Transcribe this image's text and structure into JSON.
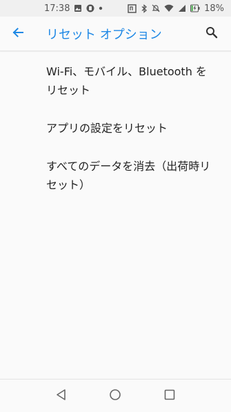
{
  "status_bar": {
    "time": "17:38",
    "battery_percent": "18%"
  },
  "app_bar": {
    "title": "リセット オプション"
  },
  "items": [
    {
      "label": "Wi-Fi、モバイル、Bluetooth をリセット"
    },
    {
      "label": "アプリの設定をリセット"
    },
    {
      "label": "すべてのデータを消去（出荷時リセット）"
    }
  ],
  "colors": {
    "accent": "#1e88e5"
  }
}
